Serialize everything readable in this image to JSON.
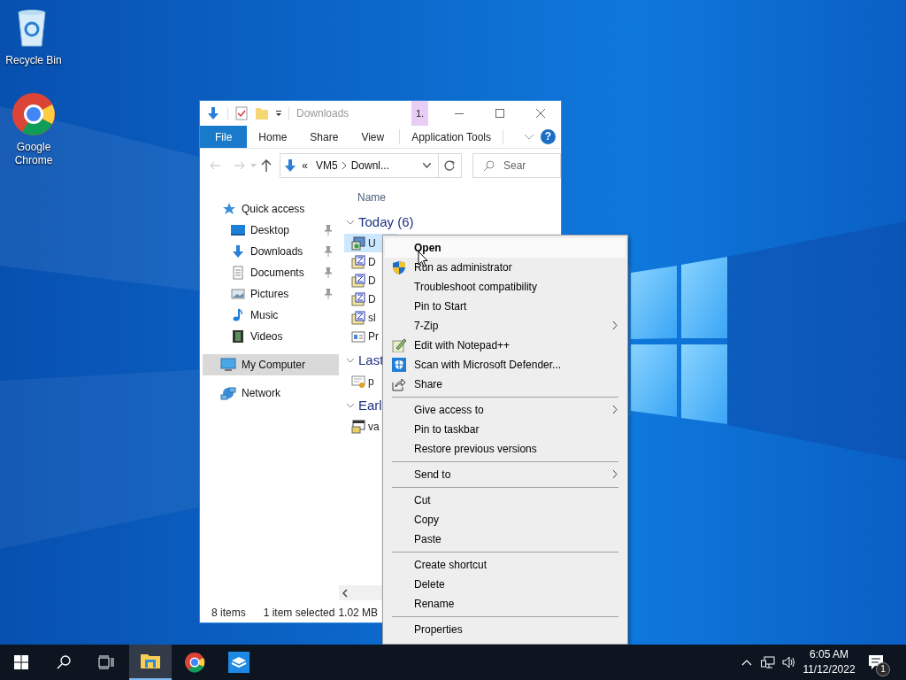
{
  "desktop_icons": [
    {
      "label": "Recycle Bin"
    },
    {
      "label": "Google Chrome"
    }
  ],
  "explorer": {
    "title": "Downloads",
    "tag": "1.",
    "file_menu": "File",
    "tabs": [
      "Home",
      "Share",
      "View"
    ],
    "context_tab": "Application Tools",
    "help": "?",
    "address": {
      "overflow": "«",
      "segments": [
        "VM5",
        "Downl..."
      ]
    },
    "search": {
      "placeholder": "Sear"
    },
    "column_header": "Name",
    "nav": [
      {
        "label": "Quick access",
        "selected": false,
        "children": [
          {
            "label": "Desktop",
            "pinned": true,
            "selected": false
          },
          {
            "label": "Downloads",
            "pinned": true,
            "selected": false
          },
          {
            "label": "Documents",
            "pinned": true,
            "selected": false
          },
          {
            "label": "Pictures",
            "pinned": true,
            "selected": false
          },
          {
            "label": "Music",
            "pinned": false,
            "selected": false
          },
          {
            "label": "Videos",
            "pinned": false,
            "selected": false
          }
        ]
      },
      {
        "label": "My Computer",
        "selected": true
      },
      {
        "label": "Network",
        "selected": false
      }
    ],
    "groups": [
      {
        "label": "Today (6)",
        "expanded": true,
        "items": [
          {
            "name": "U",
            "kind": "app",
            "selected": true
          },
          {
            "name": "D",
            "kind": "zip",
            "selected": false
          },
          {
            "name": "D",
            "kind": "zip",
            "selected": false
          },
          {
            "name": "D",
            "kind": "zip",
            "selected": false
          },
          {
            "name": "sl",
            "kind": "zip",
            "selected": false
          },
          {
            "name": "Pr",
            "kind": "form",
            "selected": false
          }
        ]
      },
      {
        "label": "Last",
        "expanded": true,
        "items": [
          {
            "name": "p",
            "kind": "cert",
            "selected": false
          }
        ]
      },
      {
        "label": "Earl",
        "expanded": true,
        "items": [
          {
            "name": "va",
            "kind": "installer",
            "selected": false
          }
        ]
      }
    ],
    "status": {
      "item_count": "8 items",
      "selection": "1 item selected",
      "size": "1.02 MB"
    }
  },
  "context_menu": [
    {
      "kind": "item",
      "label": "Open",
      "default": true,
      "highlighted": true,
      "submenu": false
    },
    {
      "kind": "item",
      "label": "Run as administrator",
      "default": false,
      "highlighted": false,
      "submenu": false
    },
    {
      "kind": "item",
      "label": "Troubleshoot compatibility",
      "default": false,
      "highlighted": false,
      "submenu": false
    },
    {
      "kind": "item",
      "label": "Pin to Start",
      "default": false,
      "highlighted": false,
      "submenu": false
    },
    {
      "kind": "item",
      "label": "7-Zip",
      "default": false,
      "highlighted": false,
      "submenu": true
    },
    {
      "kind": "item",
      "label": "Edit with Notepad++",
      "default": false,
      "highlighted": false,
      "submenu": false
    },
    {
      "kind": "item",
      "label": "Scan with Microsoft Defender...",
      "default": false,
      "highlighted": false,
      "submenu": false
    },
    {
      "kind": "item",
      "label": "Share",
      "default": false,
      "highlighted": false,
      "submenu": false
    },
    {
      "kind": "separator"
    },
    {
      "kind": "item",
      "label": "Give access to",
      "default": false,
      "highlighted": false,
      "submenu": true
    },
    {
      "kind": "item",
      "label": "Pin to taskbar",
      "default": false,
      "highlighted": false,
      "submenu": false
    },
    {
      "kind": "item",
      "label": "Restore previous versions",
      "default": false,
      "highlighted": false,
      "submenu": false
    },
    {
      "kind": "separator"
    },
    {
      "kind": "item",
      "label": "Send to",
      "default": false,
      "highlighted": false,
      "submenu": true
    },
    {
      "kind": "separator"
    },
    {
      "kind": "item",
      "label": "Cut",
      "default": false,
      "highlighted": false,
      "submenu": false
    },
    {
      "kind": "item",
      "label": "Copy",
      "default": false,
      "highlighted": false,
      "submenu": false
    },
    {
      "kind": "item",
      "label": "Paste",
      "default": false,
      "highlighted": false,
      "submenu": false
    },
    {
      "kind": "separator"
    },
    {
      "kind": "item",
      "label": "Create shortcut",
      "default": false,
      "highlighted": false,
      "submenu": false
    },
    {
      "kind": "item",
      "label": "Delete",
      "default": false,
      "highlighted": false,
      "submenu": false
    },
    {
      "kind": "item",
      "label": "Rename",
      "default": false,
      "highlighted": false,
      "submenu": false
    },
    {
      "kind": "separator"
    },
    {
      "kind": "item",
      "label": "Properties",
      "default": false,
      "highlighted": false,
      "submenu": false
    }
  ],
  "taskbar": {
    "apps": [
      {
        "selected": true
      },
      {
        "selected": false
      },
      {
        "selected": false
      }
    ],
    "time": "6:05 AM",
    "date": "11/12/2022",
    "notifications": "1"
  }
}
